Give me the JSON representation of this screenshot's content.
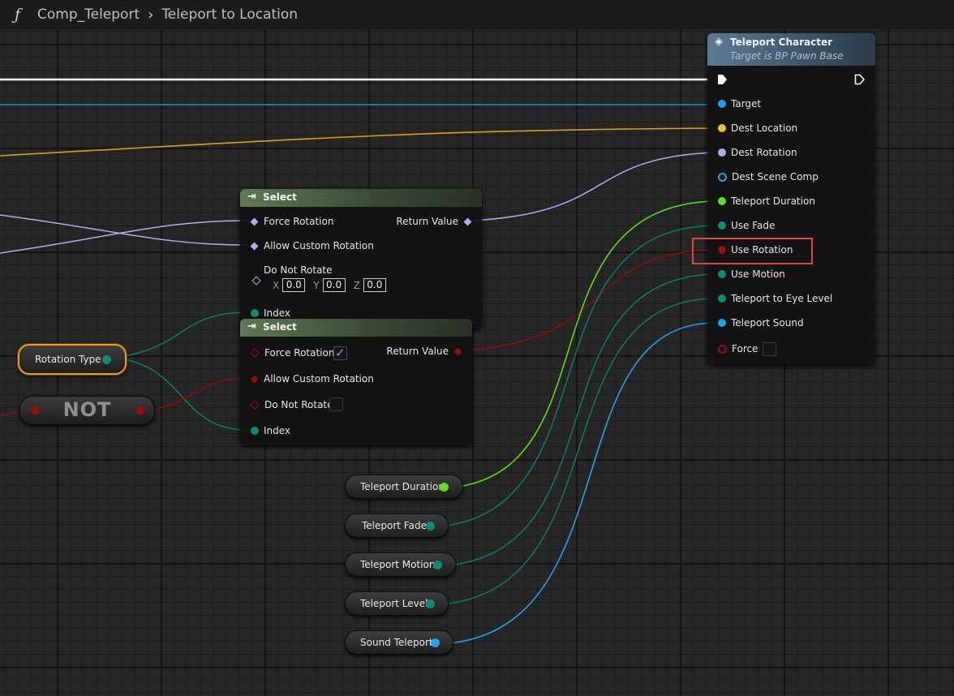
{
  "breadcrumb": {
    "icon": "function-icon",
    "blueprint": "Comp_Teleport",
    "function": "Teleport to Location"
  },
  "colors": {
    "exec": "#ffffff",
    "object": "#1ea3ee",
    "vector": "#f0c030",
    "rotator": "#a8b0f0",
    "float": "#5fdc1e",
    "byte": "#0e8a7a",
    "bool": "#9a0d0d",
    "highlight": "#e04848",
    "selection": "#e89b23"
  },
  "select_rotator": {
    "title": "Select",
    "pins": {
      "force_rotation": "Force Rotation",
      "allow_custom": "Allow Custom Rotation",
      "do_not_rotate": "Do Not Rotate",
      "index": "Index",
      "return_value": "Return Value"
    },
    "vector": {
      "x_label": "X",
      "x": "0.0",
      "y_label": "Y",
      "y": "0.0",
      "z_label": "Z",
      "z": "0.0"
    }
  },
  "select_bool": {
    "title": "Select",
    "pins": {
      "force_rotation": "Force Rotation",
      "allow_custom": "Allow Custom Rotation",
      "do_not_rotate": "Do Not Rotate",
      "index": "Index",
      "return_value": "Return Value"
    },
    "force_rotation_checked": true,
    "do_not_rotate_checked": false
  },
  "teleport": {
    "title": "Teleport Character",
    "subtitle": "Target is BP Pawn Base",
    "pins": {
      "target": "Target",
      "dest_location": "Dest Location",
      "dest_rotation": "Dest Rotation",
      "dest_scene_comp": "Dest Scene Comp",
      "teleport_duration": "Teleport Duration",
      "use_fade": "Use Fade",
      "use_rotation": "Use Rotation",
      "use_motion": "Use Motion",
      "teleport_eye_level": "Teleport to Eye Level",
      "teleport_sound": "Teleport Sound",
      "force": "Force"
    },
    "force_checked": false
  },
  "variables": {
    "rotation_type": "Rotation Type",
    "teleport_duration": "Teleport Duration",
    "teleport_fade": "Teleport Fade",
    "teleport_motion": "Teleport Motion",
    "teleport_level": "Teleport Level",
    "sound_teleport": "Sound Teleport"
  },
  "not_node": {
    "label": "NOT"
  }
}
